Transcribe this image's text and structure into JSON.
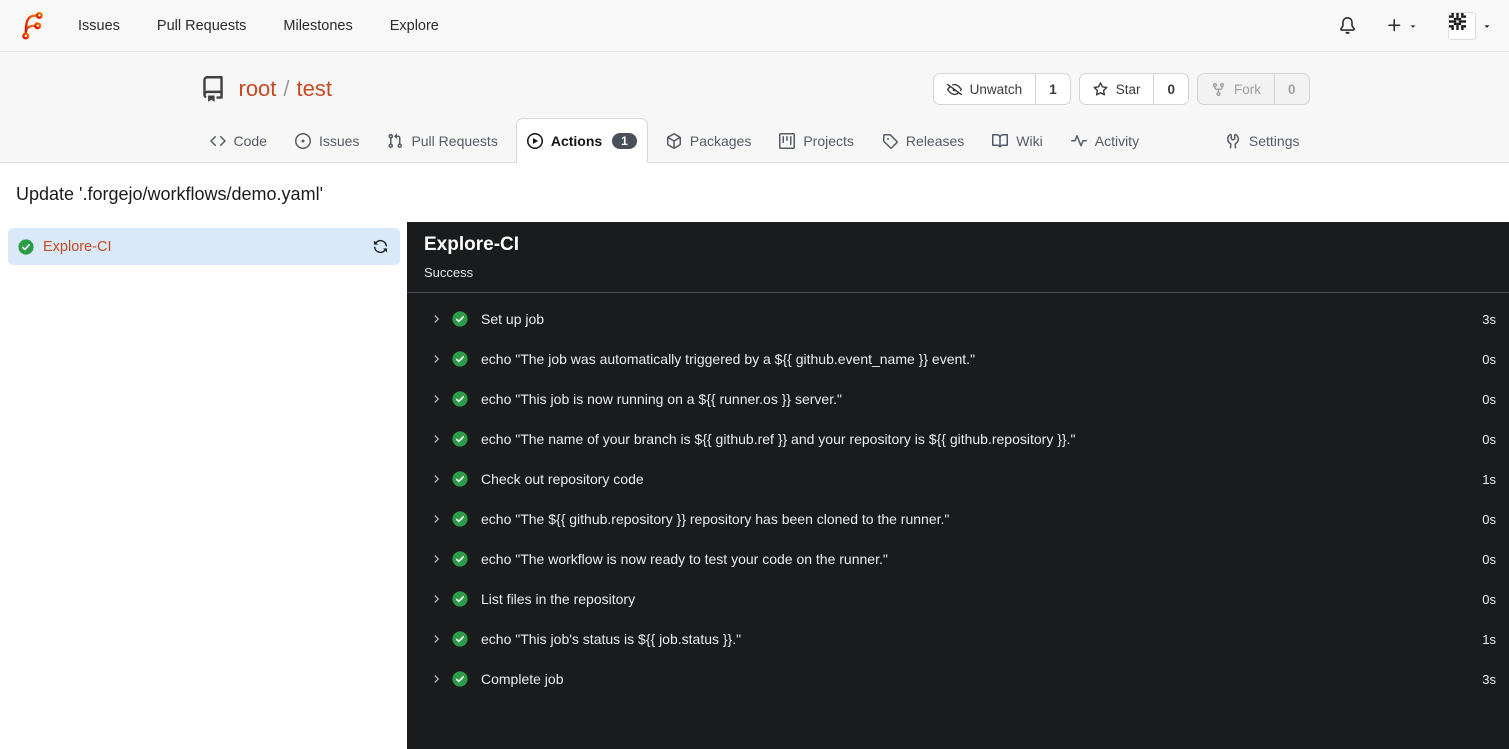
{
  "navbar": {
    "logo_icon": "forgejo-logo",
    "links": [
      {
        "label": "Issues"
      },
      {
        "label": "Pull Requests"
      },
      {
        "label": "Milestones"
      },
      {
        "label": "Explore"
      }
    ],
    "notifications_icon": "bell-icon",
    "create_icon": "plus-icon",
    "dropdown_icon": "triangle-down-icon",
    "avatar_icon": "identicon-avatar"
  },
  "repo_header": {
    "repo_icon": "repo-icon",
    "owner": "root",
    "separator": "/",
    "name": "test",
    "actions": [
      {
        "icon": "eye-closed-icon",
        "label": "Unwatch",
        "count": "1",
        "disabled": false
      },
      {
        "icon": "star-icon",
        "label": "Star",
        "count": "0",
        "disabled": false
      },
      {
        "icon": "fork-icon",
        "label": "Fork",
        "count": "0",
        "disabled": true
      }
    ],
    "tabs": [
      {
        "icon": "code-icon",
        "label": "Code",
        "active": false
      },
      {
        "icon": "issue-icon",
        "label": "Issues",
        "active": false
      },
      {
        "icon": "pull-request-icon",
        "label": "Pull Requests",
        "active": false
      },
      {
        "icon": "play-circle-icon",
        "label": "Actions",
        "active": true,
        "badge": "1"
      },
      {
        "icon": "package-icon",
        "label": "Packages",
        "active": false
      },
      {
        "icon": "project-icon",
        "label": "Projects",
        "active": false
      },
      {
        "icon": "tag-icon",
        "label": "Releases",
        "active": false
      },
      {
        "icon": "book-icon",
        "label": "Wiki",
        "active": false
      },
      {
        "icon": "pulse-icon",
        "label": "Activity",
        "active": false
      }
    ],
    "settings_tab": {
      "icon": "tools-icon",
      "label": "Settings"
    }
  },
  "run": {
    "title": "Update '.forgejo/workflows/demo.yaml'",
    "jobs": [
      {
        "status_icon": "check-circle-icon",
        "label": "Explore-CI",
        "refresh_icon": "sync-icon",
        "selected": true
      }
    ],
    "detail": {
      "title": "Explore-CI",
      "status": "Success",
      "steps": [
        {
          "name": "Set up job",
          "duration": "3s"
        },
        {
          "name": "echo \"The job was automatically triggered by a ${{ github.event_name }} event.\"",
          "duration": "0s"
        },
        {
          "name": "echo \"This job is now running on a ${{ runner.os }} server.\"",
          "duration": "0s"
        },
        {
          "name": "echo \"The name of your branch is ${{ github.ref }} and your repository is ${{ github.repository }}.\"",
          "duration": "0s"
        },
        {
          "name": "Check out repository code",
          "duration": "1s"
        },
        {
          "name": "echo \"The ${{ github.repository }} repository has been cloned to the runner.\"",
          "duration": "0s"
        },
        {
          "name": "echo \"The workflow is now ready to test your code on the runner.\"",
          "duration": "0s"
        },
        {
          "name": "List files in the repository",
          "duration": "0s"
        },
        {
          "name": "echo \"This job's status is ${{ job.status }}.\"",
          "duration": "1s"
        },
        {
          "name": "Complete job",
          "duration": "3s"
        }
      ]
    }
  },
  "colors": {
    "primary_orange": "#c7491f",
    "success_green": "#2c9d47",
    "console_bg": "#1a1b1d",
    "selected_job_bg": "#d9e9f9",
    "badge_bg": "#4a5059"
  }
}
